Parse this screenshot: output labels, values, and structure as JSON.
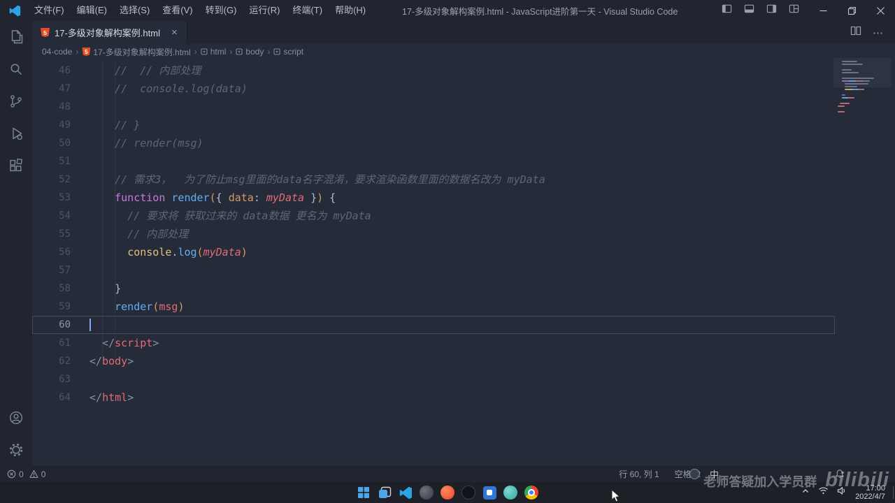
{
  "titlebar": {
    "menus": [
      "文件(F)",
      "编辑(E)",
      "选择(S)",
      "查看(V)",
      "转到(G)",
      "运行(R)",
      "终端(T)",
      "帮助(H)"
    ],
    "title": "17-多级对象解构案例.html - JavaScript进阶第一天 - Visual Studio Code"
  },
  "tabbar": {
    "tab_label": "17-多级对象解构案例.html",
    "close_glyph": "×",
    "more_glyph": "⋯",
    "file_badge": "5"
  },
  "breadcrumb": {
    "items": [
      "04-code",
      "17-多级对象解构案例.html",
      "html",
      "body",
      "script"
    ],
    "separator": "›"
  },
  "editor": {
    "lines": [
      {
        "n": "46",
        "tokens": [
          [
            "cm",
            "    //  // 内部处理"
          ]
        ]
      },
      {
        "n": "47",
        "tokens": [
          [
            "cm",
            "    //  console.log(data)"
          ]
        ]
      },
      {
        "n": "48",
        "tokens": []
      },
      {
        "n": "49",
        "tokens": [
          [
            "cm",
            "    // }"
          ]
        ]
      },
      {
        "n": "50",
        "tokens": [
          [
            "cm",
            "    // render(msg)"
          ]
        ]
      },
      {
        "n": "51",
        "tokens": []
      },
      {
        "n": "52",
        "tokens": [
          [
            "cm",
            "    // 需求3，  为了防止msg里面的data名字混淆，要求渲染函数里面的数据名改为 myData"
          ]
        ]
      },
      {
        "n": "53",
        "tokens": [
          [
            "pl",
            "    "
          ],
          [
            "kw",
            "function"
          ],
          [
            "pl",
            " "
          ],
          [
            "fn",
            "render"
          ],
          [
            "pa",
            "("
          ],
          [
            "pl",
            "{ "
          ],
          [
            "pr",
            "data"
          ],
          [
            "pl",
            ": "
          ],
          [
            "vr",
            "myData"
          ],
          [
            "pl",
            " }"
          ],
          [
            "pa",
            ")"
          ],
          [
            "pl",
            " {"
          ]
        ]
      },
      {
        "n": "54",
        "tokens": [
          [
            "cm",
            "      // 要求将 获取过来的 data数据 更名为 myData"
          ]
        ]
      },
      {
        "n": "55",
        "tokens": [
          [
            "cm",
            "      // 内部处理"
          ]
        ]
      },
      {
        "n": "56",
        "tokens": [
          [
            "pl",
            "      "
          ],
          [
            "sp",
            "console"
          ],
          [
            "pl",
            "."
          ],
          [
            "fn",
            "log"
          ],
          [
            "pa",
            "("
          ],
          [
            "vr",
            "myData"
          ],
          [
            "pa",
            ")"
          ]
        ]
      },
      {
        "n": "57",
        "tokens": []
      },
      {
        "n": "58",
        "tokens": [
          [
            "pl",
            "    }"
          ]
        ]
      },
      {
        "n": "59",
        "tokens": [
          [
            "pl",
            "    "
          ],
          [
            "fn",
            "render"
          ],
          [
            "pa",
            "("
          ],
          [
            "rd",
            "msg"
          ],
          [
            "pa",
            ")"
          ]
        ]
      },
      {
        "n": "60",
        "tokens": [],
        "current": true
      },
      {
        "n": "61",
        "tokens": [
          [
            "pl",
            "  "
          ],
          [
            "pu",
            "</"
          ],
          [
            "tg",
            "script"
          ],
          [
            "pu",
            ">"
          ]
        ]
      },
      {
        "n": "62",
        "tokens": [
          [
            "pu",
            "</"
          ],
          [
            "tg",
            "body"
          ],
          [
            "pu",
            ">"
          ]
        ]
      },
      {
        "n": "63",
        "tokens": []
      },
      {
        "n": "64",
        "tokens": [
          [
            "pu",
            "</"
          ],
          [
            "tg",
            "html"
          ],
          [
            "pu",
            ">"
          ]
        ]
      }
    ]
  },
  "statusbar": {
    "errors": "0",
    "warnings": "0",
    "cursor_position": "行 60, 列 1",
    "indentation": "空格: 2",
    "ime": "中"
  },
  "watermark": {
    "caption": "老师答疑加入学员群",
    "logo": "bilibili"
  },
  "taskbar": {
    "time": "17:00",
    "date": "2022/4/7"
  },
  "theme": {
    "editor_bg": "#262b3a",
    "chrome_bg": "#21252f",
    "taskbar_bg": "#1d2027",
    "comment_gray": "#5e6673",
    "keyword_purple": "#c678dd",
    "function_blue": "#61afef",
    "variable_red": "#e06c75",
    "property_gold": "#d19a66",
    "support_yellow": "#e5c07b",
    "html_icon_orange": "#e44d26"
  }
}
